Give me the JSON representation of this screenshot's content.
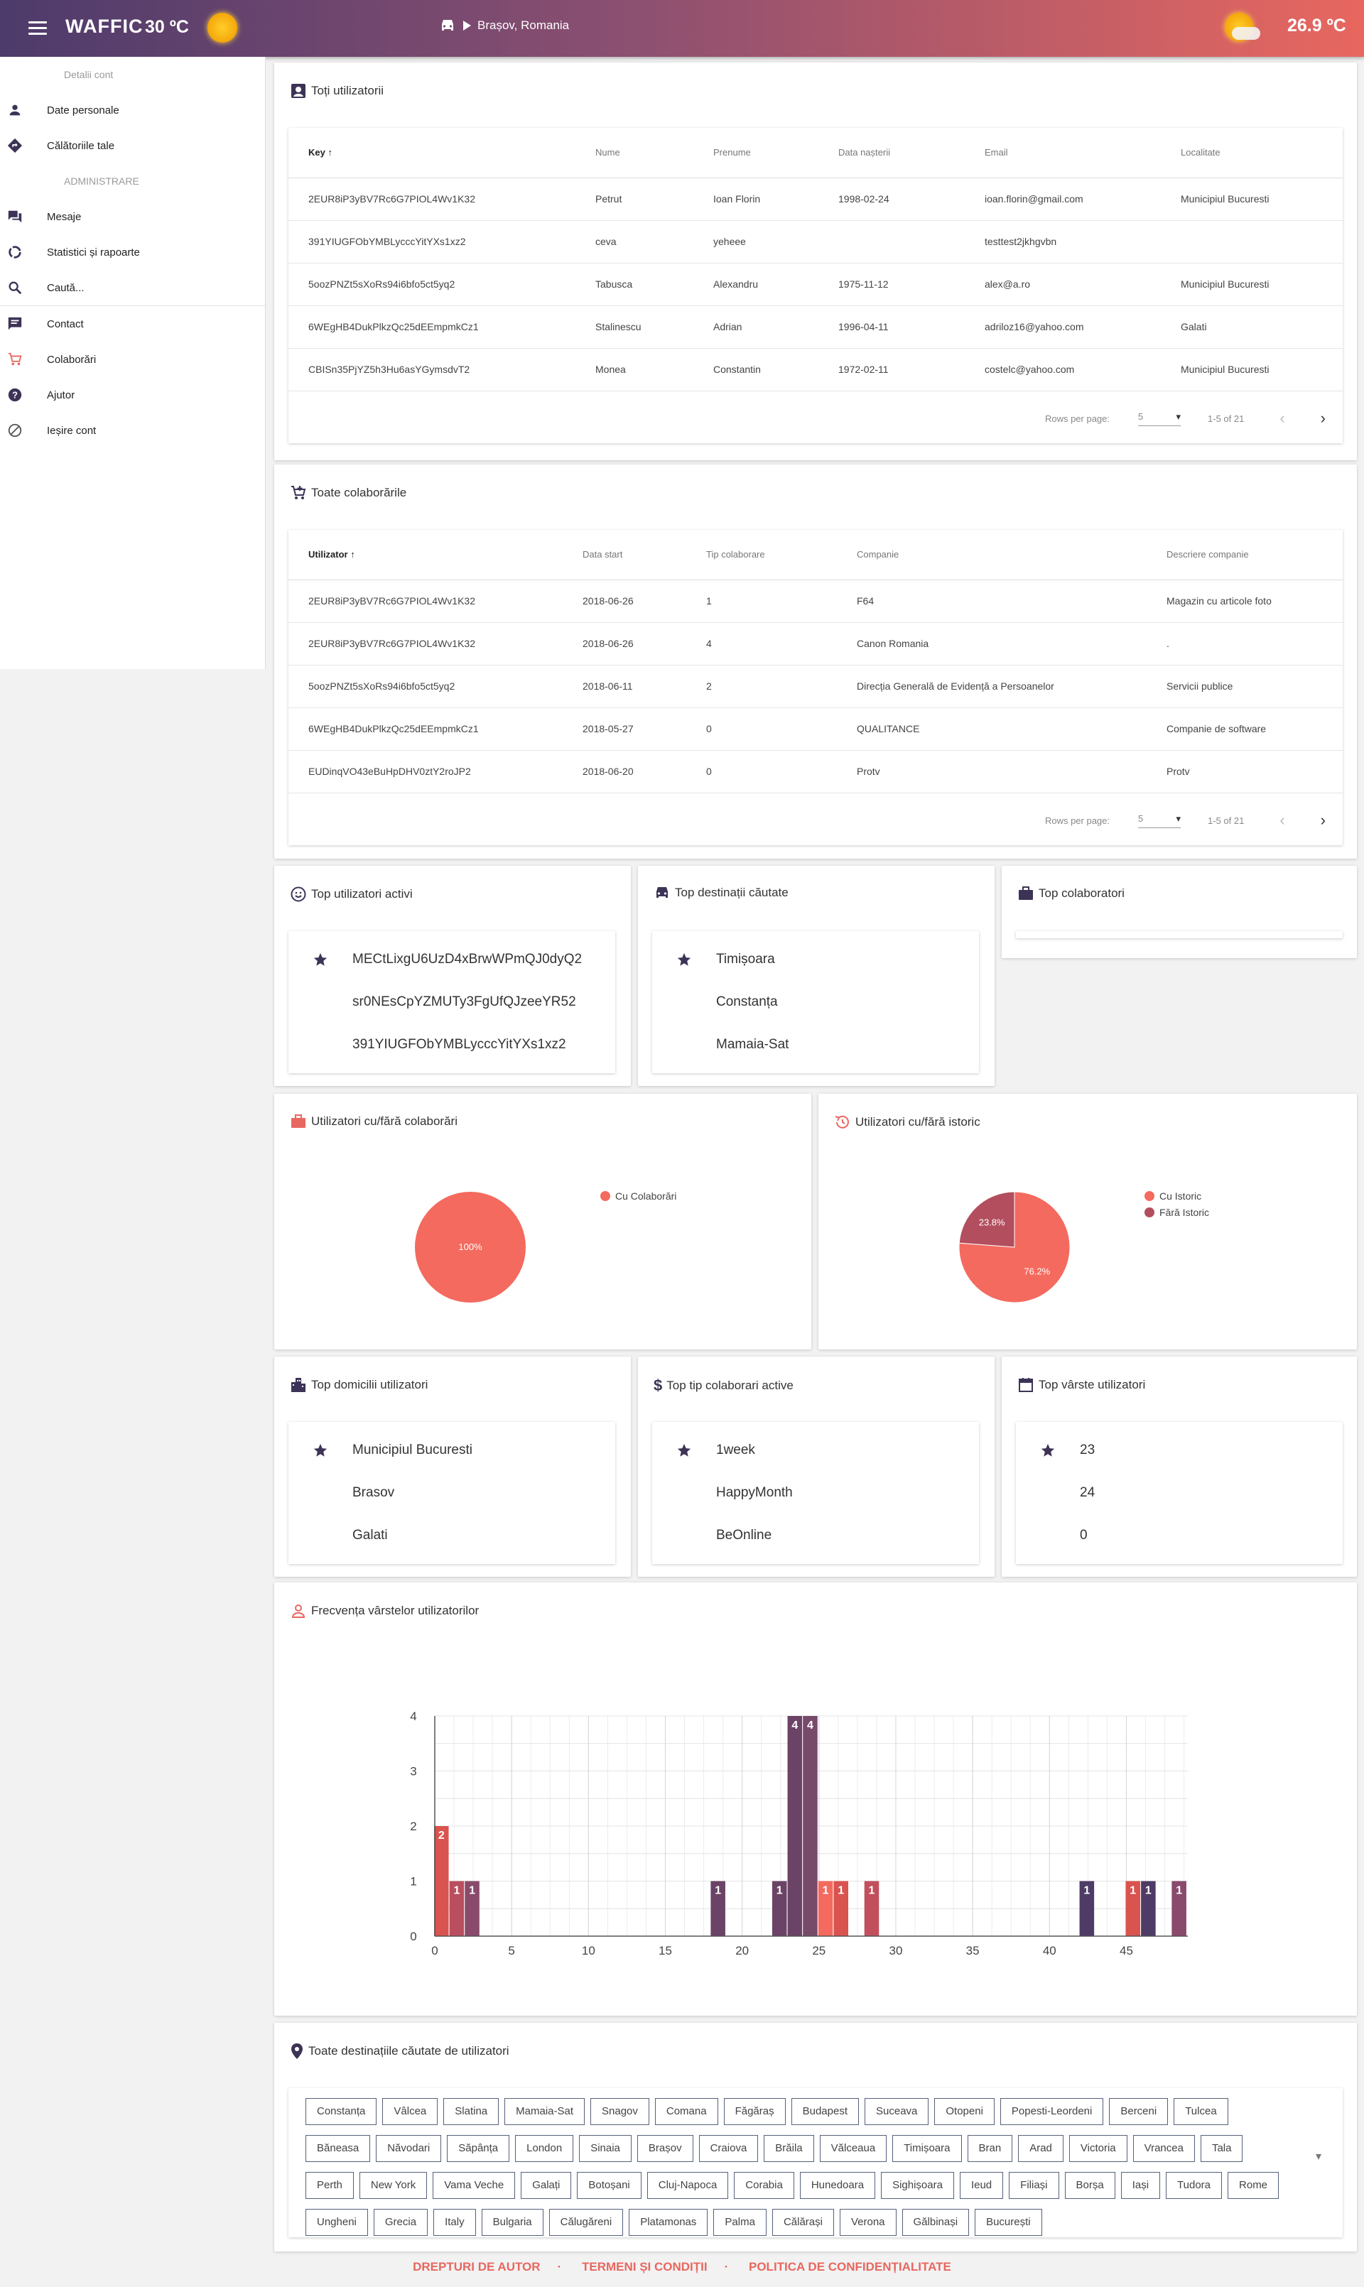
{
  "header": {
    "app_name": "WAFFIC",
    "temp_left": "30 ºC",
    "location": "Brașov, Romania",
    "temp_right": "26.9 ºC"
  },
  "sidebar": {
    "section1": "Detalii cont",
    "items1": [
      {
        "label": "Date personale",
        "icon": "person-icon"
      },
      {
        "label": "Călătoriile tale",
        "icon": "directions-icon"
      }
    ],
    "section2": "ADMINISTRARE",
    "items2": [
      {
        "label": "Mesaje",
        "icon": "forum-icon"
      },
      {
        "label": "Statistici și rapoarte",
        "icon": "donut-icon"
      },
      {
        "label": "Caută...",
        "icon": "search-icon"
      }
    ],
    "items3": [
      {
        "label": "Contact",
        "icon": "chat-icon"
      },
      {
        "label": "Colaborări",
        "icon": "cart-icon"
      },
      {
        "label": "Ajutor",
        "icon": "help-icon"
      },
      {
        "label": "Ieșire cont",
        "icon": "block-icon"
      }
    ]
  },
  "users": {
    "title": "Toți utilizatorii",
    "headers": [
      "Key",
      "Nume",
      "Prenume",
      "Data nașterii",
      "Email",
      "Localitate"
    ],
    "rows": [
      [
        "2EUR8iP3yBV7Rc6G7PIOL4Wv1K32",
        "Petrut",
        "Ioan Florin",
        "1998-02-24",
        "ioan.florin@gmail.com",
        "Municipiul Bucuresti"
      ],
      [
        "391YIUGFObYMBLycccYitYXs1xz2",
        "ceva",
        "yeheee",
        "",
        "testtest2jkhgvbn",
        ""
      ],
      [
        "5oozPNZt5sXoRs94i6bfo5ct5yq2",
        "Tabusca",
        "Alexandru",
        "1975-11-12",
        "alex@a.ro",
        "Municipiul Bucuresti"
      ],
      [
        "6WEgHB4DukPlkzQc25dEEmpmkCz1",
        "Stalinescu",
        "Adrian",
        "1996-04-11",
        "adriloz16@yahoo.com",
        "Galati"
      ],
      [
        "CBISn35PjYZ5h3Hu6asYGymsdvT2",
        "Monea",
        "Constantin",
        "1972-02-11",
        "costelc@yahoo.com",
        "Municipiul Bucuresti"
      ]
    ],
    "rows_per_page_label": "Rows per page:",
    "rows_per_page": "5",
    "range": "1-5 of 21"
  },
  "collabs": {
    "title": "Toate colaborările",
    "headers": [
      "Utilizator",
      "Data start",
      "Tip colaborare",
      "Companie",
      "Descriere companie"
    ],
    "rows": [
      [
        "2EUR8iP3yBV7Rc6G7PIOL4Wv1K32",
        "2018-06-26",
        "1",
        "F64",
        "Magazin cu articole foto"
      ],
      [
        "2EUR8iP3yBV7Rc6G7PIOL4Wv1K32",
        "2018-06-26",
        "4",
        "Canon Romania",
        "."
      ],
      [
        "5oozPNZt5sXoRs94i6bfo5ct5yq2",
        "2018-06-11",
        "2",
        "Direcția Generală de Evidență a Persoanelor",
        "Servicii publice"
      ],
      [
        "6WEgHB4DukPlkzQc25dEEmpmkCz1",
        "2018-05-27",
        "0",
        "QUALITANCE",
        "Companie de software"
      ],
      [
        "EUDinqVO43eBuHpDHV0ztY2roJP2",
        "2018-06-20",
        "0",
        "Protv",
        "Protv"
      ]
    ],
    "rows_per_page_label": "Rows per page:",
    "rows_per_page": "5",
    "range": "1-5 of 21"
  },
  "top_users": {
    "title": "Top utilizatori activi",
    "items": [
      "MECtLixgU6UzD4xBrwWPmQJ0dyQ2",
      "sr0NEsCpYZMUTy3FgUfQJzeeYR52",
      "391YIUGFObYMBLycccYitYXs1xz2"
    ]
  },
  "top_dest": {
    "title": "Top destinații căutate",
    "items": [
      "Timișoara",
      "Constanța",
      "Mamaia-Sat"
    ]
  },
  "top_collab": {
    "title": "Top colaboratori"
  },
  "pie1": {
    "title": "Utilizatori cu/fără colaborări",
    "legend": [
      "Cu Colaborări"
    ],
    "label": "100%",
    "colors": [
      "#f46a5e"
    ]
  },
  "pie2": {
    "title": "Utilizatori cu/fără istoric",
    "legend": [
      "Cu Istoric",
      "Fără Istoric"
    ],
    "labels": [
      "76.2%",
      "23.8%"
    ],
    "values": [
      76.2,
      23.8
    ],
    "colors": [
      "#f46a5e",
      "#b24e5e"
    ]
  },
  "top_dom": {
    "title": "Top domicilii utilizatori",
    "items": [
      "Municipiul Bucuresti",
      "Brasov",
      "Galati"
    ]
  },
  "top_tip": {
    "title": "Top tip colaborari active",
    "items": [
      "1week",
      "HappyMonth",
      "BeOnline"
    ]
  },
  "top_age": {
    "title": "Top vârste utilizatori",
    "items": [
      "23",
      "24",
      "0"
    ]
  },
  "age_chart_title": "Frecvența vârstelor utilizatorilor",
  "chart_data": {
    "type": "bar",
    "xlim": [
      0,
      48
    ],
    "ylim": [
      0,
      4
    ],
    "xticks": [
      0,
      5,
      10,
      15,
      20,
      25,
      30,
      35,
      40,
      45
    ],
    "yticks": [
      0,
      1,
      2,
      3,
      4
    ],
    "grid": true,
    "points": [
      {
        "x": 0,
        "y": 2,
        "c": "#d9534f"
      },
      {
        "x": 1,
        "y": 1,
        "c": "#b94e5e"
      },
      {
        "x": 2,
        "y": 1,
        "c": "#8a4a6c"
      },
      {
        "x": 18,
        "y": 1,
        "c": "#6b4366"
      },
      {
        "x": 22,
        "y": 1,
        "c": "#6b4366"
      },
      {
        "x": 23,
        "y": 4,
        "c": "#6b4366"
      },
      {
        "x": 24,
        "y": 4,
        "c": "#784a6a"
      },
      {
        "x": 25,
        "y": 1,
        "c": "#f46a5e"
      },
      {
        "x": 26,
        "y": 1,
        "c": "#d9534f"
      },
      {
        "x": 28,
        "y": 1,
        "c": "#c14f5c"
      },
      {
        "x": 42,
        "y": 1,
        "c": "#4e3b66"
      },
      {
        "x": 45,
        "y": 1,
        "c": "#d9534f"
      },
      {
        "x": 46,
        "y": 1,
        "c": "#4e3b66"
      },
      {
        "x": 48,
        "y": 1,
        "c": "#8a4a6c"
      }
    ]
  },
  "destinations": {
    "title": "Toate destinațiile căutate de utilizatori",
    "chips": [
      "Constanța",
      "Vâlcea",
      "Slatina",
      "Mamaia-Sat",
      "Snagov",
      "Comana",
      "Făgăraș",
      "Budapest",
      "Suceava",
      "Otopeni",
      "Popesti-Leordeni",
      "Berceni",
      "Tulcea",
      "Băneasa",
      "Năvodari",
      "Săpânța",
      "London",
      "Sinaia",
      "Brașov",
      "Craiova",
      "Brăila",
      "Vălceaua",
      "Timișoara",
      "Bran",
      "Arad",
      "Victoria",
      "Vrancea",
      "Tala",
      "Perth",
      "New York",
      "Vama Veche",
      "Galați",
      "Botoșani",
      "Cluj-Napoca",
      "Corabia",
      "Hunedoara",
      "Sighișoara",
      "Ieud",
      "Filiași",
      "Borșa",
      "Iași",
      "Tudora",
      "Rome",
      "Ungheni",
      "Grecia",
      "Italy",
      "Bulgaria",
      "Călugăreni",
      "Platamonas",
      "Palma",
      "Călărași",
      "Verona",
      "Gălbinași",
      "București"
    ]
  },
  "footer": {
    "links": [
      "DREPTURI DE AUTOR",
      "TERMENI ȘI CONDIȚII",
      "POLITICA DE CONFIDENȚIALITATE"
    ]
  }
}
